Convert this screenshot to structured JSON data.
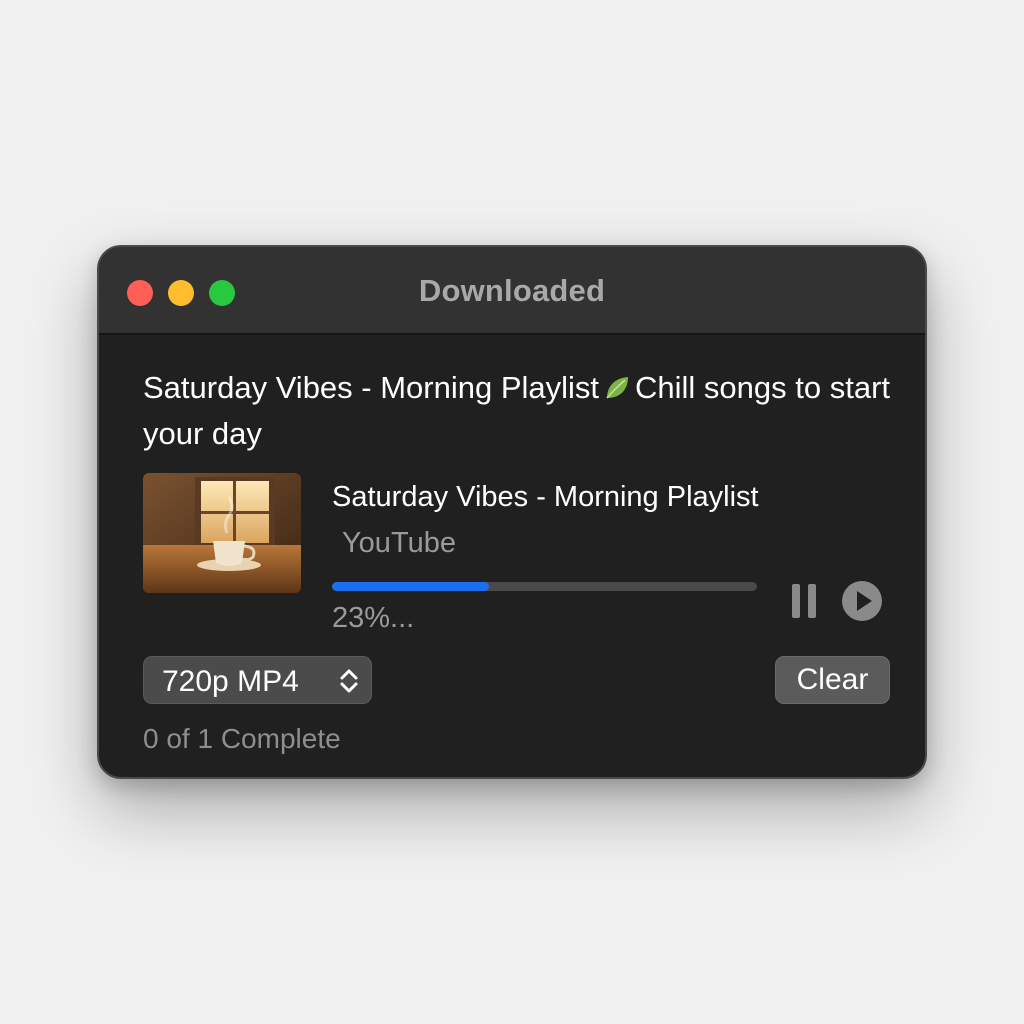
{
  "window": {
    "title": "Downloaded"
  },
  "playlist": {
    "title_part1": "Saturday Vibes - Morning Playlist",
    "title_part2": "Chill songs to start your day",
    "emoji_icon": "leaf-icon"
  },
  "download_item": {
    "title": "Saturday Vibes - Morning Playlist",
    "source": "YouTube",
    "progress_fraction": 0.37,
    "progress_label": "23%...",
    "thumbnail_icon": "coffee-cup-window-thumbnail"
  },
  "controls": {
    "pause_icon": "pause-icon",
    "play_icon": "play-icon"
  },
  "format_select": {
    "selected": "720p MP4",
    "icon": "chevron-up-down-icon"
  },
  "clear_button": {
    "label": "Clear"
  },
  "status": {
    "text": "0 of 1 Complete"
  },
  "colors": {
    "accent": "#1a6ff0",
    "window_bg": "#202020",
    "titlebar_bg": "#323232",
    "close": "#ff5f57",
    "minimize": "#febc2e",
    "zoom": "#28c840"
  }
}
